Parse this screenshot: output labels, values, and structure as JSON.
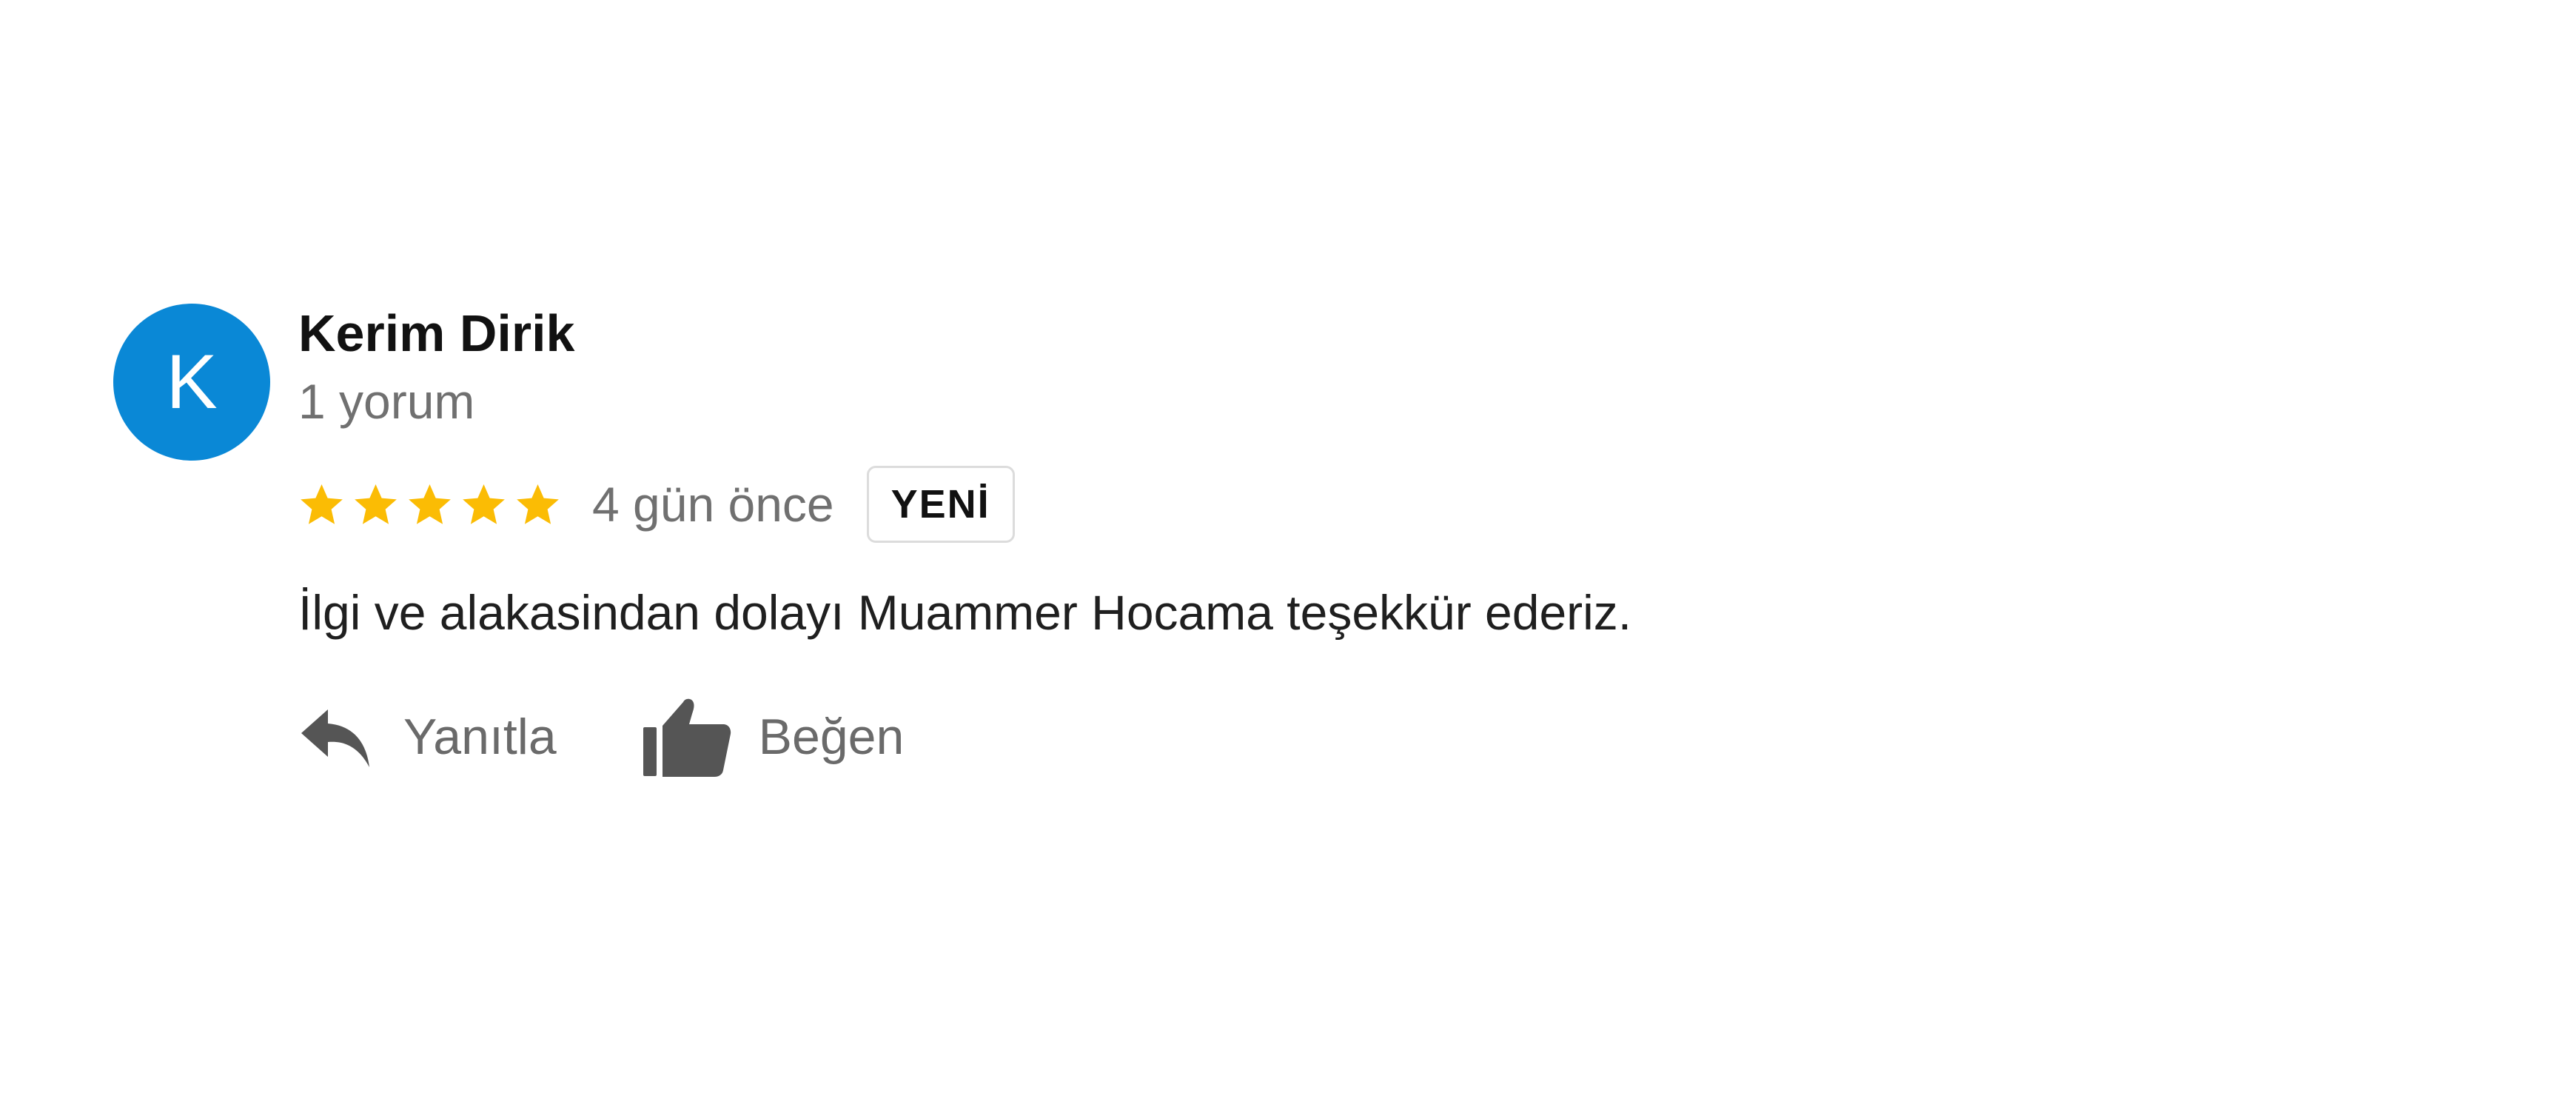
{
  "review": {
    "avatar_letter": "K",
    "avatar_color": "#0a88d6",
    "author_name": "Kerim Dirik",
    "review_count": "1 yorum",
    "rating": 5,
    "rating_max": 5,
    "star_color": "#fbbc04",
    "date": "4 gün önce",
    "badge": "YENİ",
    "text": "İlgi ve alakasindan dolayı Muammer Hocama teşekkür ederiz.",
    "actions": {
      "reply_label": "Yanıtla",
      "reply_icon": "reply-icon",
      "like_label": "Beğen",
      "like_icon": "thumbs-up-icon"
    }
  }
}
